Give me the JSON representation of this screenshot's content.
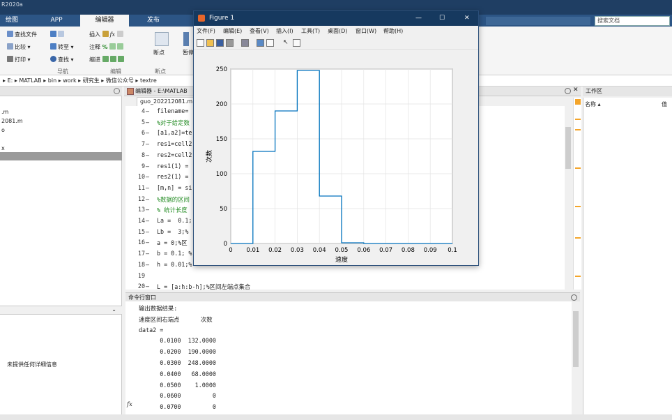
{
  "app_title": "R2020a",
  "ribbon_tabs": [
    "绘图",
    "APP",
    "编辑器",
    "发布"
  ],
  "ribbon": {
    "file_find": "查找文件",
    "compare": "比较 ▾",
    "print": "打印 ▾",
    "goto": "转至 ▾",
    "find": "查找 ▾",
    "insert": "插入",
    "comment": "注释",
    "indent": "缩进",
    "breakpoint": "断点",
    "pause": "暂停",
    "group_nav": "导航",
    "group_edit": "编辑",
    "group_bp": "断点",
    "search_placeholder": "搜索文档"
  },
  "address": {
    "crumbs": [
      "E:",
      "MATLAB",
      "bin",
      "work",
      "研究生",
      "微信公众号",
      "textre"
    ]
  },
  "left_panel": {
    "files": [
      ".m",
      "2081.m",
      "o",
      "",
      "x"
    ],
    "details": "未提供任何详细信息"
  },
  "editor": {
    "header": "编辑器 - E:\\MATLAB",
    "tab": "guo_202212081.m",
    "lines": [
      {
        "n": "4",
        "t": "filename=",
        "c": false
      },
      {
        "n": "5",
        "t": "%对于给定数",
        "c": true
      },
      {
        "n": "6",
        "t": "[a1,a2]=te",
        "c": false
      },
      {
        "n": "7",
        "t": "res1=cell2",
        "c": false
      },
      {
        "n": "8",
        "t": "res2=cell2",
        "c": false
      },
      {
        "n": "9",
        "t": "res1(1) = ",
        "c": false
      },
      {
        "n": "10",
        "t": "res2(1) = ",
        "c": false
      },
      {
        "n": "11",
        "t": "[m,n] = si",
        "c": false
      },
      {
        "n": "12",
        "t": "%数据的区间",
        "c": true
      },
      {
        "n": "13",
        "t": "% 统计长度",
        "c": true
      },
      {
        "n": "14",
        "t": "La =  0.1;",
        "c": false
      },
      {
        "n": "15",
        "t": "Lb =  3;%",
        "c": false
      },
      {
        "n": "16",
        "t": "a = 0;%区",
        "c": false
      },
      {
        "n": "17",
        "t": "b = 0.1; %",
        "c": false
      },
      {
        "n": "18",
        "t": "h = 0.01;%",
        "c": false
      },
      {
        "n": "19",
        "t": "",
        "c": false
      },
      {
        "n": "20",
        "t": "L = [a:h:b-h];%区间左端点集合",
        "c": false
      }
    ]
  },
  "command_window": {
    "title": "命令行窗口",
    "lines": [
      "输出数据结果:",
      "速度区间右端点      次数",
      "data2 =",
      "      0.0100  132.0000",
      "      0.0200  190.0000",
      "      0.0300  248.0000",
      "      0.0400   68.0000",
      "      0.0500    1.0000",
      "      0.0600         0",
      "      0.0700         0"
    ],
    "prompt": "fx"
  },
  "workspace": {
    "title": "工作区",
    "col_name": "名称 ▴",
    "col_value": "值"
  },
  "figure": {
    "title": "Figure 1",
    "menu": [
      "文件(F)",
      "编辑(E)",
      "查看(V)",
      "插入(I)",
      "工具(T)",
      "桌面(D)",
      "窗口(W)",
      "帮助(H)"
    ],
    "win_min": "—",
    "win_max": "☐",
    "win_close": "✕"
  },
  "chart_data": {
    "type": "line",
    "style": "stairs",
    "xlabel": "速度",
    "ylabel": "次数",
    "xlim": [
      0,
      0.1
    ],
    "ylim": [
      0,
      250
    ],
    "xticks": [
      "0",
      "0.01",
      "0.02",
      "0.03",
      "0.04",
      "0.05",
      "0.06",
      "0.07",
      "0.08",
      "0.09",
      "0.1"
    ],
    "yticks": [
      "0",
      "50",
      "100",
      "150",
      "200",
      "250"
    ],
    "grid": true,
    "color": "#0072bd",
    "x": [
      0,
      0.01,
      0.02,
      0.03,
      0.04,
      0.05,
      0.06,
      0.07,
      0.08,
      0.09,
      0.1
    ],
    "y": [
      0,
      132,
      190,
      248,
      68,
      1,
      0,
      0,
      0,
      0,
      0
    ]
  }
}
